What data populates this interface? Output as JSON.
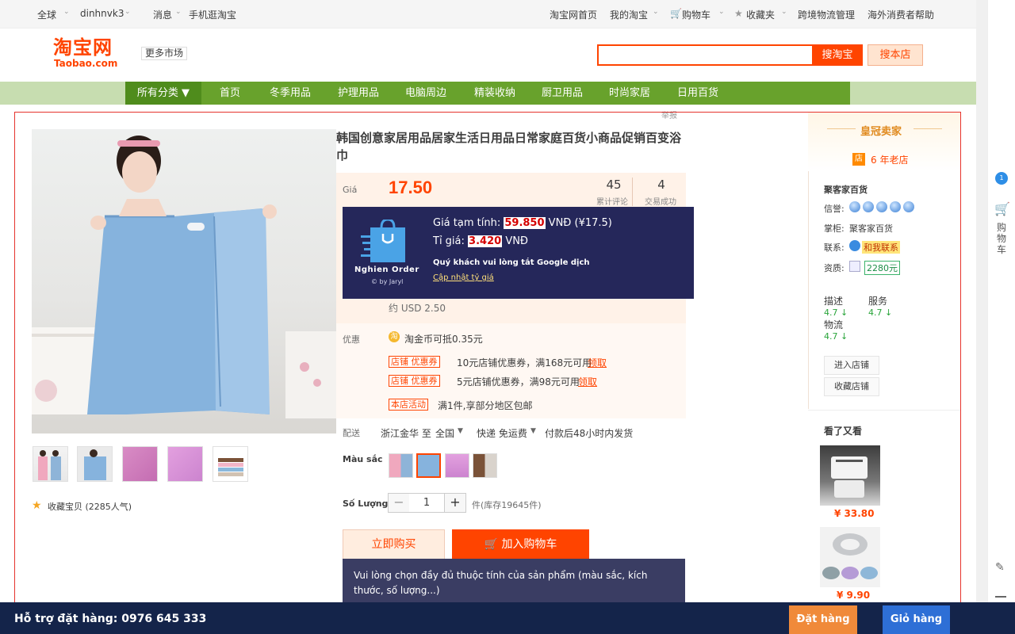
{
  "topbar": {
    "region": "全球",
    "username": "dinhnvk3",
    "messages": "消息",
    "mobile": "手机逛淘宝",
    "home": "淘宝网首页",
    "my_taobao": "我的淘宝",
    "cart": "购物车",
    "favorites": "收藏夹",
    "logistics": "跨境物流管理",
    "help": "海外消费者帮助"
  },
  "header": {
    "logo_main": "淘宝网",
    "logo_sub": "Taobao.com",
    "more_market": "更多市场",
    "search_value": "",
    "search_btn": "搜淘宝",
    "search_shop_btn": "搜本店"
  },
  "nav": {
    "all_categories": "所有分类 ▼",
    "items": [
      "首页",
      "冬季用品",
      "护理用品",
      "电脑周边",
      "精装收纳",
      "厨卫用品",
      "时尚家居",
      "日用百货"
    ]
  },
  "report": "举报",
  "product": {
    "title": "韩国创意家居用品居家生活日用品日常家庭百货小商品促销百变浴巾",
    "price_label": "Giá",
    "price": "17.50",
    "reviews_count": "45",
    "reviews_label": "累计评论",
    "sales_count": "4",
    "sales_label": "交易成功",
    "usd": "约 USD 2.50",
    "promo_label": "优惠",
    "coin_text": "淘金币可抵0.35元",
    "coupons": [
      {
        "tag": "店铺 优惠券",
        "text": "10元店铺优惠券，满168元可用",
        "link": "领取"
      },
      {
        "tag": "店铺 优惠券",
        "text": "5元店铺优惠券，满98元可用",
        "link": "领取"
      }
    ],
    "activity_tag": "本店活动",
    "activity_text": "满1件,享部分地区包邮",
    "delivery_label": "配送",
    "delivery_from": "浙江金华 至",
    "delivery_to": "全国",
    "delivery_type": "快递 免运费",
    "delivery_time": "付款后48小时内发货",
    "color_label": "Màu sắc",
    "qty_label": "Số Lượng",
    "qty_value": "1",
    "stock": "件(库存19645件)",
    "buy_now": "立即购买",
    "add_to_cart": "加入购物车",
    "favorite": "收藏宝贝 (2285人气)"
  },
  "overlay": {
    "logo_text": "Nghien Order",
    "logo_sub": "© by Jaryl",
    "est_label": "Giá tạm tính:",
    "est_value": "59.850",
    "est_suffix": "VNĐ (¥17.5)",
    "rate_label": "Tỉ giá:",
    "rate_value": "3.420",
    "rate_suffix": "VNĐ",
    "note": "Quý khách vui lòng tắt Google dịch",
    "update_link": "Cập nhật tỷ giá"
  },
  "tooltip": "Vui lòng chọn đầy đủ thuộc tính của sản phẩm (màu sắc, kích thước, số lượng...)",
  "seller": {
    "crown": "皇冠卖家",
    "shop_icon": "店",
    "years": "6 年老店",
    "shop_name": "聚客家百货",
    "credit_label": "信誉:",
    "owner_label": "掌柜:",
    "owner": "聚客家百货",
    "contact_label": "联系:",
    "contact": "和我联系",
    "qual_label": "资质:",
    "qual_value": "2280元",
    "desc_label": "描述",
    "desc_score": "4.7 ↓",
    "service_label": "服务",
    "service_score": "4.7 ↓",
    "logistics_label": "物流",
    "logistics_score": "4.7 ↓",
    "enter_shop": "进入店铺",
    "fav_shop": "收藏店铺",
    "see_also": "看了又看",
    "rec_prices": [
      "¥ 33.80",
      "¥ 9.90"
    ]
  },
  "sidebar": {
    "cart_vertical": "购物车"
  },
  "footer": {
    "support": "Hỗ trợ đặt hàng: 0976 645 333",
    "order_btn": "Đặt hàng",
    "cart_btn": "Giỏ hàng"
  }
}
